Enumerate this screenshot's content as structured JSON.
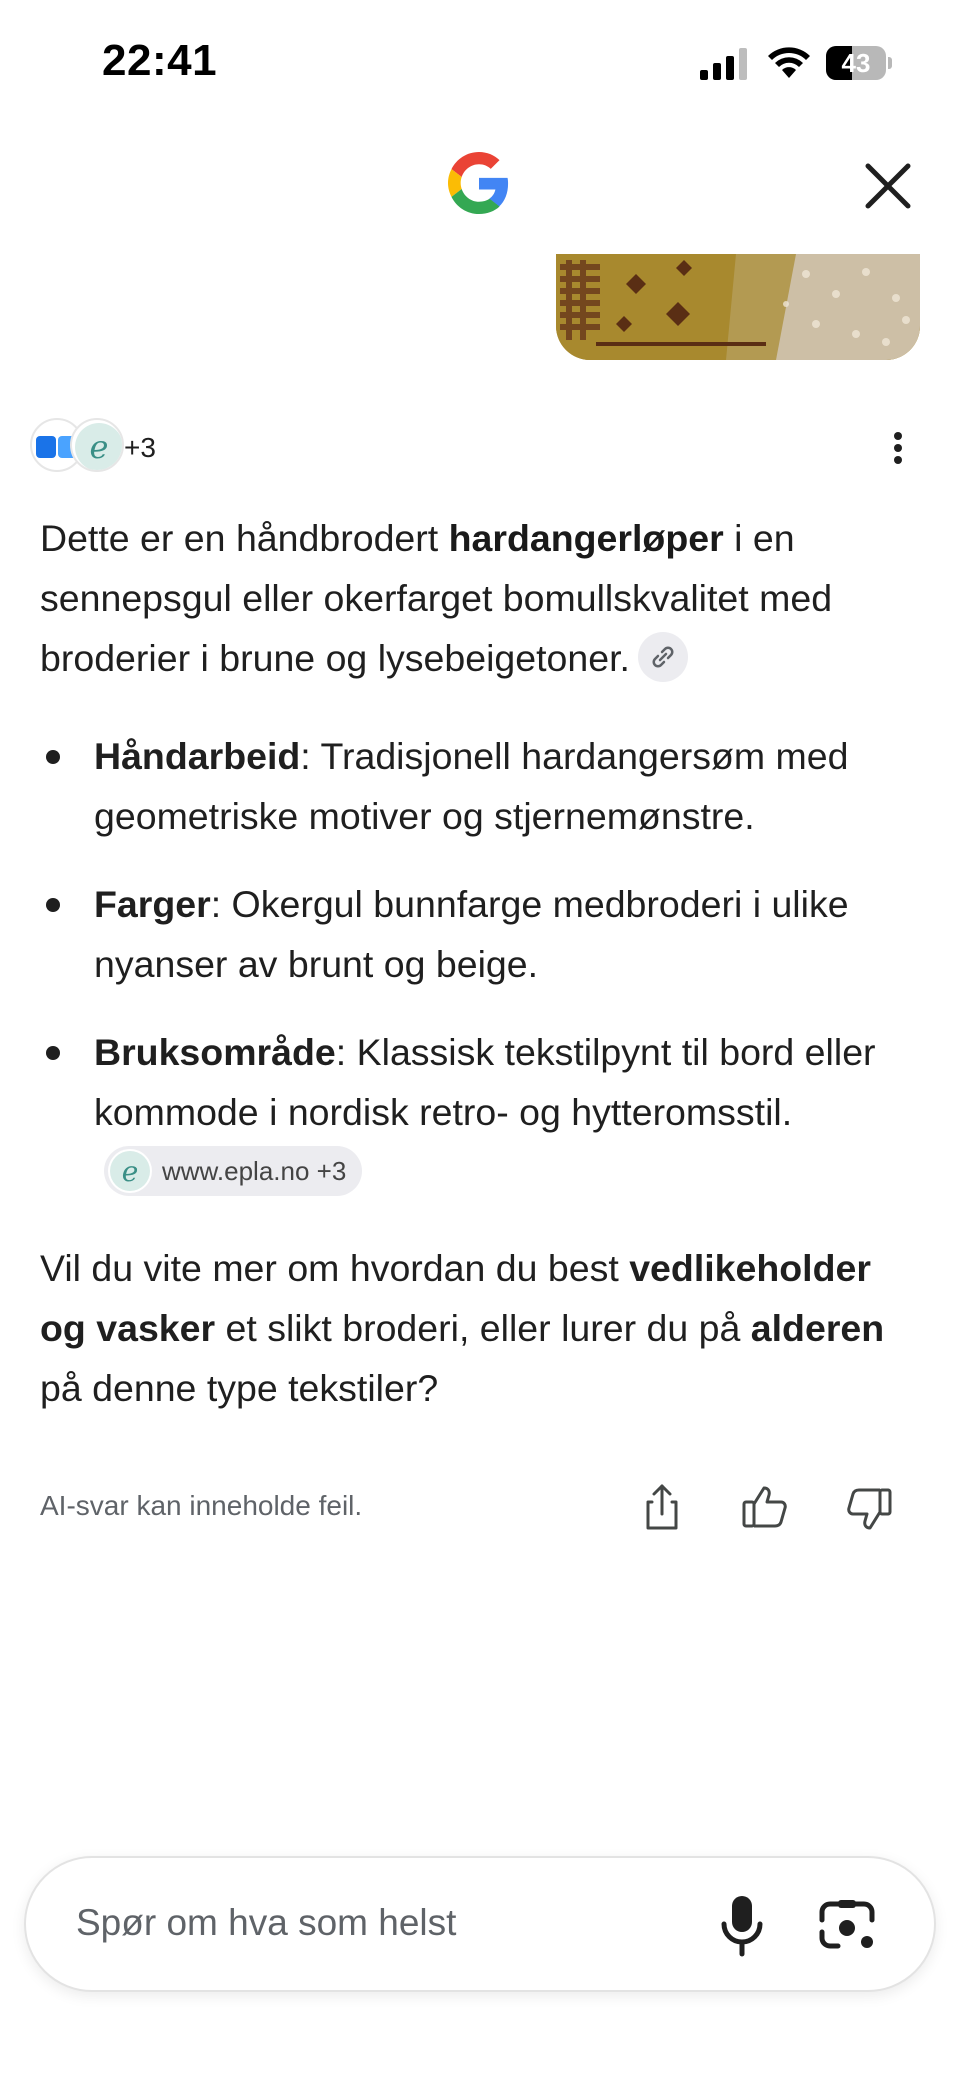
{
  "status_bar": {
    "time": "22:41",
    "battery_level": "43",
    "battery_fraction": 0.43
  },
  "header": {
    "logo_icon": "google-g-icon",
    "close_icon": "close-icon"
  },
  "sources": {
    "count_label": "+3",
    "icons": [
      "blue-squares-icon",
      "epla-logo-icon"
    ],
    "more_icon": "more-vert-icon"
  },
  "answer": {
    "intro_pre": "Dette er en håndbrodert ",
    "intro_bold": "hardangerløper",
    "intro_post": " i en sennepsgul eller okerfarget bomullskvalitet med broderier i brune og lysebeigetoner.",
    "intro_link_icon": "link-icon",
    "bullets": [
      {
        "title": "Håndarbeid",
        "text": ": Tradisjonell hardangersøm med geometriske motiver og stjernemønstre."
      },
      {
        "title": "Farger",
        "text": ": Okergul bunnfarge medbroderi i ulike nyanser av brunt og beige."
      },
      {
        "title": "Bruksområde",
        "text": ": Klassisk tekstilpynt til bord eller kommode i nordisk retro- og hytteromsstil."
      }
    ],
    "source_chip": {
      "label": "www.epla.no +3",
      "icon": "epla-logo-icon"
    },
    "followup": {
      "part1": "Vil du vite mer om hvordan du best ",
      "bold1": "vedlikeholder og vasker",
      "part2": " et slikt broderi, eller lurer du på ",
      "bold2": "alderen",
      "part3": " på denne type tekstiler?"
    }
  },
  "footer": {
    "disclaimer": "AI-svar kan inneholde feil.",
    "actions": [
      "share-icon",
      "thumbs-up-icon",
      "thumbs-down-icon"
    ]
  },
  "search": {
    "placeholder": "Spør om hva som helst",
    "mic_icon": "mic-icon",
    "lens_icon": "lens-camera-icon"
  },
  "colors": {
    "text": "#1f1f1f",
    "muted": "#5f6368",
    "chip_bg": "#ececf0",
    "google_blue": "#4285F4",
    "google_red": "#EA4335",
    "google_yellow": "#FBBC05",
    "google_green": "#34A853"
  }
}
